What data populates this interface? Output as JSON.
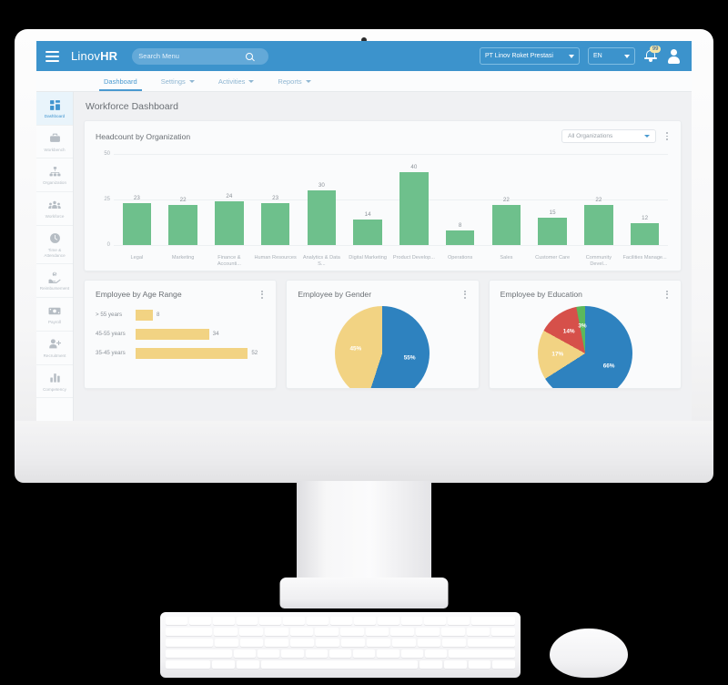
{
  "app": {
    "brand_light": "Linov",
    "brand_bold": "HR",
    "accent_blue": "#3c93cc",
    "bar_green": "#6ec08c",
    "bar_yellow": "#f2d383",
    "pie_blue": "#2e82bf",
    "pie_red": "#d6504a",
    "pie_green": "#5cb85c"
  },
  "topbar": {
    "search_placeholder": "Search Menu",
    "organization_selected": "PT Linov Roket Prestasi",
    "language_selected": "EN",
    "notification_count": "99"
  },
  "nav": [
    {
      "label": "Dashboard",
      "has_caret": false,
      "active": true
    },
    {
      "label": "Settings",
      "has_caret": true,
      "active": false
    },
    {
      "label": "Activities",
      "has_caret": true,
      "active": false
    },
    {
      "label": "Reports",
      "has_caret": true,
      "active": false
    }
  ],
  "sidebar": [
    {
      "label": "Dashboard",
      "icon": "grid-icon",
      "active": true
    },
    {
      "label": "Workbench",
      "icon": "toolbox-icon",
      "active": false
    },
    {
      "label": "Organization",
      "icon": "org-chart-icon",
      "active": false
    },
    {
      "label": "Workforce",
      "icon": "people-icon",
      "active": false
    },
    {
      "label": "Time & Attendance",
      "icon": "clock-icon",
      "active": false
    },
    {
      "label": "Reimbursement",
      "icon": "hand-money-icon",
      "active": false
    },
    {
      "label": "Payroll",
      "icon": "banknote-icon",
      "active": false
    },
    {
      "label": "Recruitment",
      "icon": "user-plus-icon",
      "active": false
    },
    {
      "label": "Competency",
      "icon": "bar-chart-icon",
      "active": false
    }
  ],
  "page": {
    "title": "Workforce Dashboard"
  },
  "headcount_card": {
    "title": "Headcount by Organization",
    "filter_value": "All Organizations"
  },
  "age_card": {
    "title": "Employee by Age Range"
  },
  "gender_card": {
    "title": "Employee by Gender"
  },
  "education_card": {
    "title": "Employee by Education"
  },
  "chart_data": [
    {
      "type": "bar",
      "title": "Headcount by Organization",
      "xlabel": "",
      "ylabel": "",
      "ylim": [
        0,
        50
      ],
      "yticks": [
        0,
        25,
        50
      ],
      "grid": true,
      "legend": "none",
      "categories": [
        "Legal",
        "Marketing",
        "Finance & Accounti...",
        "Human Resources",
        "Analytics & Data S...",
        "Digital Marketing",
        "Product Develop...",
        "Operations",
        "Sales",
        "Customer Care",
        "Community Devel...",
        "Facilities Manage..."
      ],
      "values": [
        23,
        22,
        24,
        23,
        30,
        14,
        40,
        8,
        22,
        15,
        22,
        12
      ],
      "color": "#6ec08c"
    },
    {
      "type": "bar",
      "orientation": "horizontal",
      "title": "Employee by Age Range",
      "categories": [
        "> 55 years",
        "45-55 years",
        "35-45 years"
      ],
      "values": [
        8,
        34,
        52
      ],
      "xlim": [
        0,
        60
      ],
      "color": "#f2d383"
    },
    {
      "type": "pie",
      "title": "Employee by Gender",
      "labels": [
        "55%",
        "45%"
      ],
      "values": [
        55,
        45
      ],
      "colors": [
        "#2e82bf",
        "#f2d383"
      ],
      "legend": "none"
    },
    {
      "type": "pie",
      "title": "Employee by Education",
      "labels": [
        "66%",
        "17%",
        "14%",
        "3%"
      ],
      "values": [
        66,
        17,
        14,
        3
      ],
      "colors": [
        "#2e82bf",
        "#f2d383",
        "#d6504a",
        "#5cb85c"
      ],
      "legend": "none"
    }
  ]
}
